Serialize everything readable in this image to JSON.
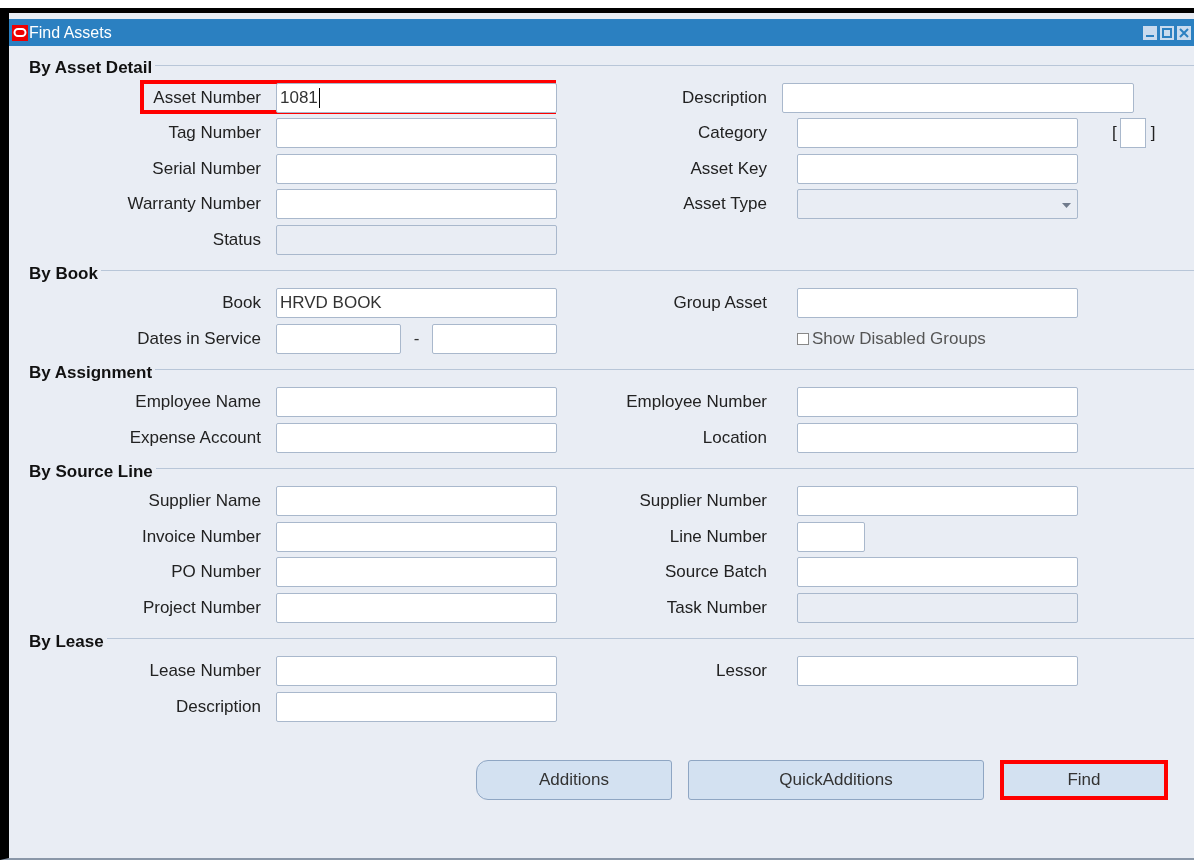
{
  "window": {
    "title": "Find Assets"
  },
  "sections": [
    {
      "title": "By Asset Detail",
      "rows": [
        {
          "left": {
            "label": "Asset Number",
            "kind": "text",
            "value": "1081",
            "focused": true,
            "highlighted": true
          },
          "right": {
            "label": "Description",
            "kind": "text-wide"
          }
        },
        {
          "left": {
            "label": "Tag Number",
            "kind": "text"
          },
          "right": {
            "label": "Category",
            "kind": "text-flex",
            "bracket_open": "[",
            "bracket_close": "]"
          }
        },
        {
          "left": {
            "label": "Serial Number",
            "kind": "text"
          },
          "right": {
            "label": "Asset Key",
            "kind": "text"
          }
        },
        {
          "left": {
            "label": "Warranty Number",
            "kind": "text"
          },
          "right": {
            "label": "Asset Type",
            "kind": "dropdown",
            "disabled": true
          }
        },
        {
          "left": {
            "label": "Status",
            "kind": "text",
            "disabled": true
          }
        }
      ]
    },
    {
      "title": "By Book",
      "rows": [
        {
          "left": {
            "label": "Book",
            "kind": "text",
            "value": "HRVD BOOK"
          },
          "right": {
            "label": "Group Asset",
            "kind": "text"
          }
        },
        {
          "left": {
            "label": "Dates in Service",
            "kind": "date-range",
            "separator": "-"
          },
          "right": {
            "label": "Show Disabled Groups",
            "kind": "checkbox",
            "checked": false
          }
        }
      ]
    },
    {
      "title": "By Assignment",
      "rows": [
        {
          "left": {
            "label": "Employee Name",
            "kind": "text"
          },
          "right": {
            "label": "Employee Number",
            "kind": "text"
          }
        },
        {
          "left": {
            "label": "Expense Account",
            "kind": "text"
          },
          "right": {
            "label": "Location",
            "kind": "text"
          }
        }
      ]
    },
    {
      "title": "By Source Line",
      "rows": [
        {
          "left": {
            "label": "Supplier Name",
            "kind": "text"
          },
          "right": {
            "label": "Supplier Number",
            "kind": "text"
          }
        },
        {
          "left": {
            "label": "Invoice Number",
            "kind": "text"
          },
          "right": {
            "label": "Line Number",
            "kind": "text-short"
          }
        },
        {
          "left": {
            "label": "PO Number",
            "kind": "text"
          },
          "right": {
            "label": "Source Batch",
            "kind": "text"
          }
        },
        {
          "left": {
            "label": "Project Number",
            "kind": "text"
          },
          "right": {
            "label": "Task Number",
            "kind": "text",
            "disabled": true
          }
        }
      ]
    },
    {
      "title": "By Lease",
      "rows": [
        {
          "left": {
            "label": "Lease Number",
            "kind": "text"
          },
          "right": {
            "label": "Lessor",
            "kind": "text"
          }
        },
        {
          "left": {
            "label": "Description",
            "kind": "text"
          }
        }
      ]
    }
  ],
  "buttons": [
    {
      "label": "Additions",
      "highlighted": false
    },
    {
      "label": "QuickAdditions",
      "highlighted": false
    },
    {
      "label": "Find",
      "highlighted": true
    }
  ]
}
